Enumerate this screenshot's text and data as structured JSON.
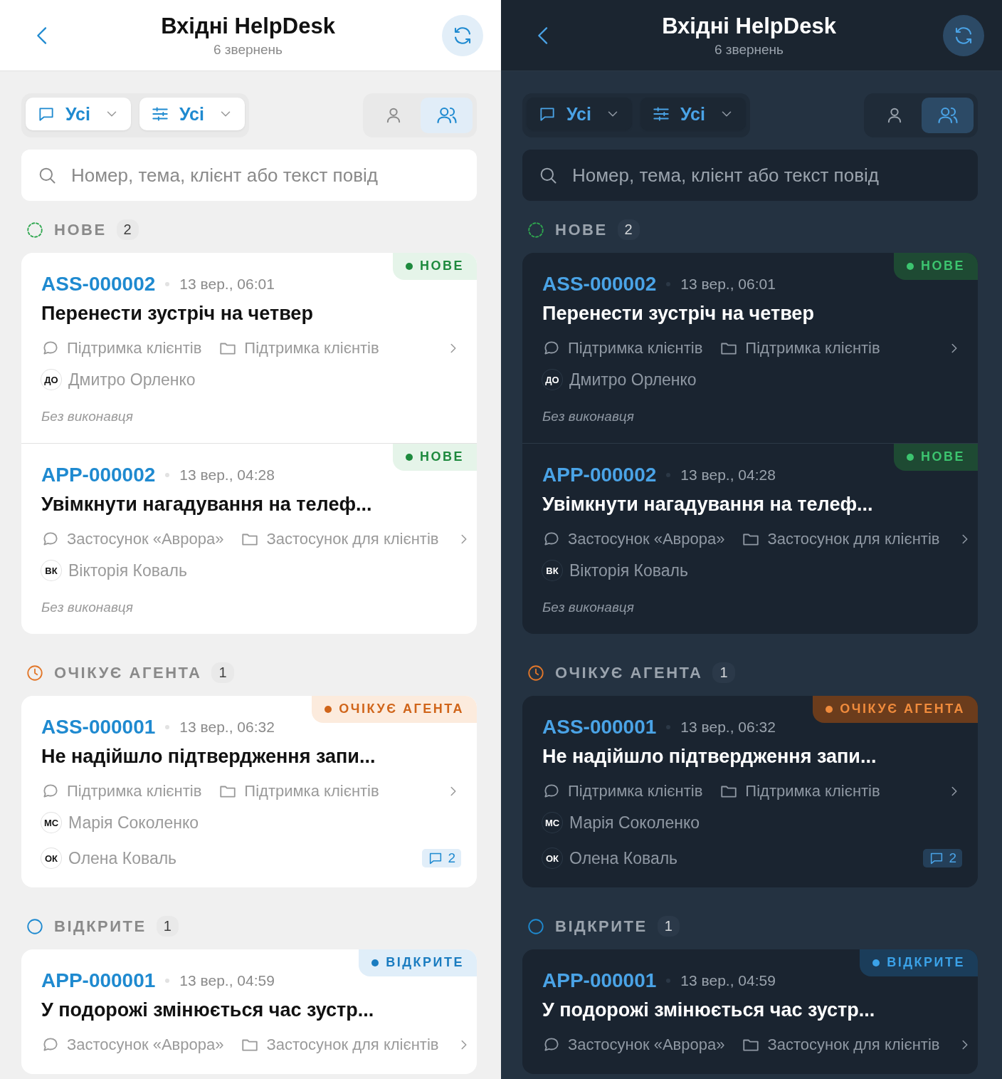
{
  "panels": [
    {
      "kind": "light",
      "header": {
        "title": "Вхідні HelpDesk",
        "subtitle": "6 звернень"
      },
      "filters": [
        {
          "kind": "channel",
          "label": "Усі"
        },
        {
          "kind": "settings",
          "label": "Усі"
        }
      ],
      "view_toggle": [
        {
          "kind": "single",
          "selected": false
        },
        {
          "kind": "group",
          "selected": true
        }
      ],
      "search": {
        "placeholder": "Номер, тема, клієнт або текст повід"
      },
      "sections": [
        {
          "kind": "new",
          "title": "НОВЕ",
          "count": "2",
          "tickets": [
            {
              "id": "ASS-000002",
              "date": "13 вер., 06:01",
              "status": {
                "kind": "new",
                "label": "НОВЕ"
              },
              "subject": "Перенести зустріч на четвер",
              "channel": "Підтримка клієнтів",
              "category": "Підтримка клієнтів",
              "client": {
                "initials": "ДО",
                "name": "Дмитро Орленко"
              },
              "assignee": {
                "kind": "none",
                "text": "Без виконавця"
              }
            },
            {
              "id": "APP-000002",
              "date": "13 вер., 04:28",
              "status": {
                "kind": "new",
                "label": "НОВЕ"
              },
              "subject": "Увімкнути нагадування на телеф...",
              "channel": "Застосунок «Аврора»",
              "category": "Застосунок для клієнтів",
              "client": {
                "initials": "ВК",
                "name": "Вікторія Коваль"
              },
              "assignee": {
                "kind": "none",
                "text": "Без виконавця"
              }
            }
          ]
        },
        {
          "kind": "waiting",
          "title": "ОЧІКУЄ АГЕНТА",
          "count": "1",
          "tickets": [
            {
              "id": "ASS-000001",
              "date": "13 вер., 06:32",
              "status": {
                "kind": "waiting",
                "label": "ОЧІКУЄ АГЕНТА"
              },
              "subject": "Не надійшло підтвердження запи...",
              "channel": "Підтримка клієнтів",
              "category": "Підтримка клієнтів",
              "client": {
                "initials": "МС",
                "name": "Марія Соколенко"
              },
              "assignee": {
                "kind": "person",
                "initials": "ОК",
                "name": "Олена Коваль"
              },
              "comments": "2"
            }
          ]
        },
        {
          "kind": "open",
          "title": "ВІДКРИТЕ",
          "count": "1",
          "tickets": [
            {
              "id": "APP-000001",
              "date": "13 вер., 04:59",
              "status": {
                "kind": "open",
                "label": "ВІДКРИТЕ"
              },
              "subject": "У подорожі змінюється час зустр...",
              "channel": "Застосунок «Аврора»",
              "category": "Застосунок для клієнтів"
            }
          ]
        }
      ]
    },
    {
      "kind": "dark",
      "header": {
        "title": "Вхідні HelpDesk",
        "subtitle": "6 звернень"
      },
      "filters": [
        {
          "kind": "channel",
          "label": "Усі"
        },
        {
          "kind": "settings",
          "label": "Усі"
        }
      ],
      "view_toggle": [
        {
          "kind": "single",
          "selected": false
        },
        {
          "kind": "group",
          "selected": true
        }
      ],
      "search": {
        "placeholder": "Номер, тема, клієнт або текст повід"
      },
      "sections": [
        {
          "kind": "new",
          "title": "НОВЕ",
          "count": "2",
          "tickets": [
            {
              "id": "ASS-000002",
              "date": "13 вер., 06:01",
              "status": {
                "kind": "new",
                "label": "НОВЕ"
              },
              "subject": "Перенести зустріч на четвер",
              "channel": "Підтримка клієнтів",
              "category": "Підтримка клієнтів",
              "client": {
                "initials": "ДО",
                "name": "Дмитро Орленко"
              },
              "assignee": {
                "kind": "none",
                "text": "Без виконавця"
              }
            },
            {
              "id": "APP-000002",
              "date": "13 вер., 04:28",
              "status": {
                "kind": "new",
                "label": "НОВЕ"
              },
              "subject": "Увімкнути нагадування на телеф...",
              "channel": "Застосунок «Аврора»",
              "category": "Застосунок для клієнтів",
              "client": {
                "initials": "ВК",
                "name": "Вікторія Коваль"
              },
              "assignee": {
                "kind": "none",
                "text": "Без виконавця"
              }
            }
          ]
        },
        {
          "kind": "waiting",
          "title": "ОЧІКУЄ АГЕНТА",
          "count": "1",
          "tickets": [
            {
              "id": "ASS-000001",
              "date": "13 вер., 06:32",
              "status": {
                "kind": "waiting",
                "label": "ОЧІКУЄ АГЕНТА"
              },
              "subject": "Не надійшло підтвердження запи...",
              "channel": "Підтримка клієнтів",
              "category": "Підтримка клієнтів",
              "client": {
                "initials": "МС",
                "name": "Марія Соколенко"
              },
              "assignee": {
                "kind": "person",
                "initials": "ОК",
                "name": "Олена Коваль"
              },
              "comments": "2"
            }
          ]
        },
        {
          "kind": "open",
          "title": "ВІДКРИТЕ",
          "count": "1",
          "tickets": [
            {
              "id": "APP-000001",
              "date": "13 вер., 04:59",
              "status": {
                "kind": "open",
                "label": "ВІДКРИТЕ"
              },
              "subject": "У подорожі змінюється час зустр...",
              "channel": "Застосунок «Аврора»",
              "category": "Застосунок для клієнтів"
            }
          ]
        }
      ]
    }
  ]
}
